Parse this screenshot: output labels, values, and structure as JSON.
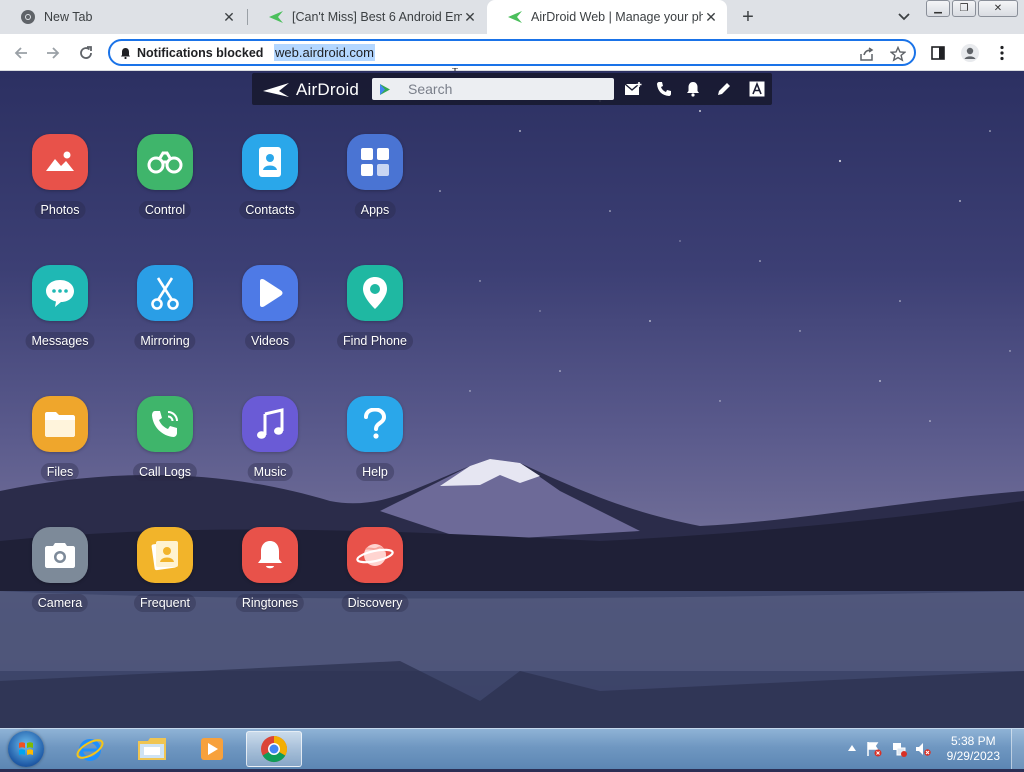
{
  "browser": {
    "tabs": [
      {
        "title": "New Tab",
        "favicon": "chrome-icon",
        "active": false
      },
      {
        "title": "[Can't Miss] Best 6 Android Emul",
        "favicon": "airdroid-icon",
        "active": false
      },
      {
        "title": "AirDroid Web | Manage your pho",
        "favicon": "airdroid-icon",
        "active": true
      }
    ],
    "address_bar": {
      "site_notice": "Notifications blocked",
      "url": "web.airdroid.com"
    }
  },
  "airdroid": {
    "logo_text": "AirDroid",
    "search_placeholder": "Search",
    "tools": [
      "sms-compose-icon",
      "phone-icon",
      "bell-icon",
      "pencil-icon",
      "font-icon"
    ],
    "apps": [
      {
        "label": "Photos",
        "icon": "photos-icon",
        "color": "#e8524a"
      },
      {
        "label": "Control",
        "icon": "binoculars-icon",
        "color": "#3fb56b"
      },
      {
        "label": "Contacts",
        "icon": "contacts-icon",
        "color": "#2aa7ea"
      },
      {
        "label": "Apps",
        "icon": "apps-grid-icon",
        "color": "#4a74d3"
      },
      {
        "label": "Messages",
        "icon": "chat-bubble-icon",
        "color": "#1fb8b4"
      },
      {
        "label": "Mirroring",
        "icon": "scissors-icon",
        "color": "#2a9ee6"
      },
      {
        "label": "Videos",
        "icon": "play-icon",
        "color": "#4e7ae6"
      },
      {
        "label": "Find Phone",
        "icon": "location-pin-icon",
        "color": "#1fb8a2"
      },
      {
        "label": "Files",
        "icon": "folder-icon",
        "color": "#efa62c"
      },
      {
        "label": "Call Logs",
        "icon": "call-icon",
        "color": "#3fb56b"
      },
      {
        "label": "Music",
        "icon": "music-note-icon",
        "color": "#6a5bd6"
      },
      {
        "label": "Help",
        "icon": "question-icon",
        "color": "#2aa7ea"
      },
      {
        "label": "Camera",
        "icon": "camera-icon",
        "color": "#7d8a99"
      },
      {
        "label": "Frequent",
        "icon": "frequent-contacts-icon",
        "color": "#f2b42a"
      },
      {
        "label": "Ringtones",
        "icon": "bell-icon",
        "color": "#e8524a"
      },
      {
        "label": "Discovery",
        "icon": "planet-icon",
        "color": "#e8524a"
      }
    ]
  },
  "taskbar": {
    "time": "5:38 PM",
    "date": "9/29/2023"
  }
}
